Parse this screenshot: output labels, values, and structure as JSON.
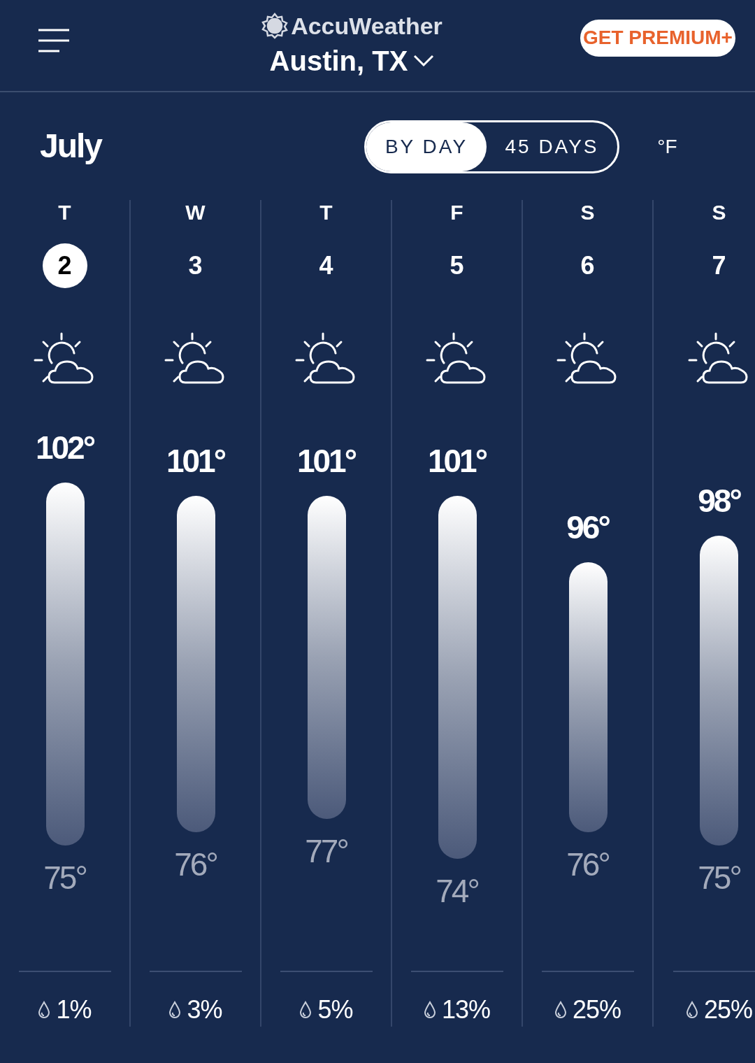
{
  "header": {
    "brand": "AccuWeather",
    "location": "Austin, TX",
    "premium_button": "GET PREMIUM+"
  },
  "month": "July",
  "view_tabs": [
    {
      "label": "BY DAY",
      "selected": true
    },
    {
      "label": "45 DAYS",
      "selected": false
    }
  ],
  "unit": "°F",
  "days": [
    {
      "weekday": "T",
      "date": "2",
      "selected": true,
      "high": "102°",
      "low": "75°",
      "precip": "1%"
    },
    {
      "weekday": "W",
      "date": "3",
      "selected": false,
      "high": "101°",
      "low": "76°",
      "precip": "3%"
    },
    {
      "weekday": "T",
      "date": "4",
      "selected": false,
      "high": "101°",
      "low": "77°",
      "precip": "5%"
    },
    {
      "weekday": "F",
      "date": "5",
      "selected": false,
      "high": "101°",
      "low": "74°",
      "precip": "13%"
    },
    {
      "weekday": "S",
      "date": "6",
      "selected": false,
      "high": "96°",
      "low": "76°",
      "precip": "25%"
    },
    {
      "weekday": "S",
      "date": "7",
      "selected": false,
      "high": "98°",
      "low": "75°",
      "precip": "25%"
    }
  ]
}
